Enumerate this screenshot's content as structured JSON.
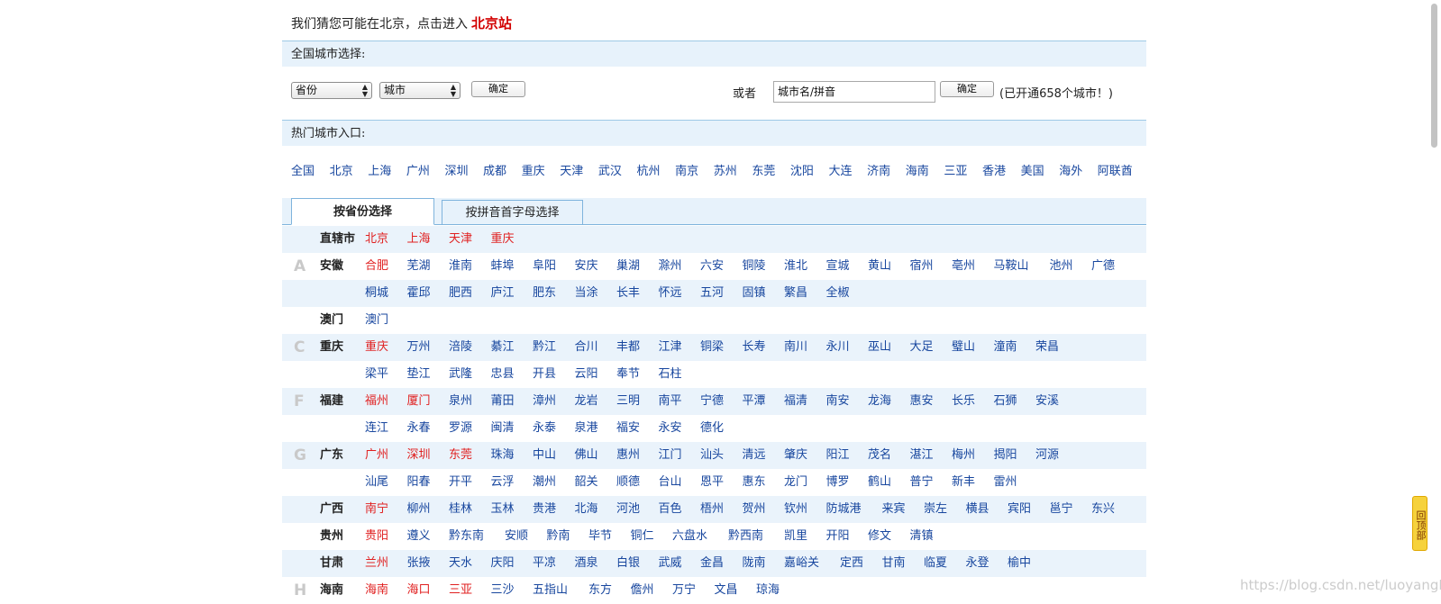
{
  "guess": {
    "prefix": "我们猜您可能在北京，点击进入",
    "city_link": "北京站"
  },
  "national": {
    "title": "全国城市选择:",
    "province_select": "省份",
    "city_select": "城市",
    "confirm_label": "确定",
    "or_label": "或者",
    "search_value": "城市名/拼音",
    "confirm2_label": "确定",
    "opened_text": "(已开通658个城市！)"
  },
  "hot": {
    "title": "热门城市入口:",
    "cities": [
      "全国",
      "北京",
      "上海",
      "广州",
      "深圳",
      "成都",
      "重庆",
      "天津",
      "武汉",
      "杭州",
      "南京",
      "苏州",
      "东莞",
      "沈阳",
      "大连",
      "济南",
      "海南",
      "三亚",
      "香港",
      "美国",
      "海外",
      "阿联酋"
    ]
  },
  "tabs": [
    {
      "label": "按省份选择"
    },
    {
      "label": "按拼音首字母选择"
    }
  ],
  "rows": [
    {
      "letter": "",
      "province": "直辖市",
      "cities": [
        {
          "n": "北京",
          "r": true
        },
        {
          "n": "上海",
          "r": true
        },
        {
          "n": "天津",
          "r": true
        },
        {
          "n": "重庆",
          "r": true
        }
      ]
    },
    {
      "letter": "A",
      "province": "安徽",
      "cities": [
        {
          "n": "合肥",
          "r": true
        },
        {
          "n": "芜湖"
        },
        {
          "n": "淮南"
        },
        {
          "n": "蚌埠"
        },
        {
          "n": "阜阳"
        },
        {
          "n": "安庆"
        },
        {
          "n": "巢湖"
        },
        {
          "n": "滁州"
        },
        {
          "n": "六安"
        },
        {
          "n": "铜陵"
        },
        {
          "n": "淮北"
        },
        {
          "n": "宣城"
        },
        {
          "n": "黄山"
        },
        {
          "n": "宿州"
        },
        {
          "n": "亳州"
        },
        {
          "n": "马鞍山"
        },
        {
          "n": "池州"
        },
        {
          "n": "广德"
        }
      ]
    },
    {
      "letter": "",
      "province": "",
      "cities": [
        {
          "n": "桐城"
        },
        {
          "n": "霍邱"
        },
        {
          "n": "肥西"
        },
        {
          "n": "庐江"
        },
        {
          "n": "肥东"
        },
        {
          "n": "当涂"
        },
        {
          "n": "长丰"
        },
        {
          "n": "怀远"
        },
        {
          "n": "五河"
        },
        {
          "n": "固镇"
        },
        {
          "n": "繁昌"
        },
        {
          "n": "全椒"
        }
      ]
    },
    {
      "letter": "",
      "province": "澳门",
      "cities": [
        {
          "n": "澳门"
        }
      ]
    },
    {
      "letter": "C",
      "province": "重庆",
      "cities": [
        {
          "n": "重庆",
          "r": true
        },
        {
          "n": "万州"
        },
        {
          "n": "涪陵"
        },
        {
          "n": "綦江"
        },
        {
          "n": "黔江"
        },
        {
          "n": "合川"
        },
        {
          "n": "丰都"
        },
        {
          "n": "江津"
        },
        {
          "n": "铜梁"
        },
        {
          "n": "长寿"
        },
        {
          "n": "南川"
        },
        {
          "n": "永川"
        },
        {
          "n": "巫山"
        },
        {
          "n": "大足"
        },
        {
          "n": "璧山"
        },
        {
          "n": "潼南"
        },
        {
          "n": "荣昌"
        }
      ]
    },
    {
      "letter": "",
      "province": "",
      "cities": [
        {
          "n": "梁平"
        },
        {
          "n": "垫江"
        },
        {
          "n": "武隆"
        },
        {
          "n": "忠县"
        },
        {
          "n": "开县"
        },
        {
          "n": "云阳"
        },
        {
          "n": "奉节"
        },
        {
          "n": "石柱"
        }
      ]
    },
    {
      "letter": "F",
      "province": "福建",
      "cities": [
        {
          "n": "福州",
          "r": true
        },
        {
          "n": "厦门",
          "r": true
        },
        {
          "n": "泉州"
        },
        {
          "n": "莆田"
        },
        {
          "n": "漳州"
        },
        {
          "n": "龙岩"
        },
        {
          "n": "三明"
        },
        {
          "n": "南平"
        },
        {
          "n": "宁德"
        },
        {
          "n": "平潭"
        },
        {
          "n": "福清"
        },
        {
          "n": "南安"
        },
        {
          "n": "龙海"
        },
        {
          "n": "惠安"
        },
        {
          "n": "长乐"
        },
        {
          "n": "石狮"
        },
        {
          "n": "安溪"
        }
      ]
    },
    {
      "letter": "",
      "province": "",
      "cities": [
        {
          "n": "连江"
        },
        {
          "n": "永春"
        },
        {
          "n": "罗源"
        },
        {
          "n": "闽清"
        },
        {
          "n": "永泰"
        },
        {
          "n": "泉港"
        },
        {
          "n": "福安"
        },
        {
          "n": "永安"
        },
        {
          "n": "德化"
        }
      ]
    },
    {
      "letter": "G",
      "province": "广东",
      "cities": [
        {
          "n": "广州",
          "r": true
        },
        {
          "n": "深圳",
          "r": true
        },
        {
          "n": "东莞",
          "r": true
        },
        {
          "n": "珠海"
        },
        {
          "n": "中山"
        },
        {
          "n": "佛山"
        },
        {
          "n": "惠州"
        },
        {
          "n": "江门"
        },
        {
          "n": "汕头"
        },
        {
          "n": "清远"
        },
        {
          "n": "肇庆"
        },
        {
          "n": "阳江"
        },
        {
          "n": "茂名"
        },
        {
          "n": "湛江"
        },
        {
          "n": "梅州"
        },
        {
          "n": "揭阳"
        },
        {
          "n": "河源"
        }
      ]
    },
    {
      "letter": "",
      "province": "",
      "cities": [
        {
          "n": "汕尾"
        },
        {
          "n": "阳春"
        },
        {
          "n": "开平"
        },
        {
          "n": "云浮"
        },
        {
          "n": "潮州"
        },
        {
          "n": "韶关"
        },
        {
          "n": "顺德"
        },
        {
          "n": "台山"
        },
        {
          "n": "恩平"
        },
        {
          "n": "惠东"
        },
        {
          "n": "龙门"
        },
        {
          "n": "博罗"
        },
        {
          "n": "鹤山"
        },
        {
          "n": "普宁"
        },
        {
          "n": "新丰"
        },
        {
          "n": "雷州"
        }
      ]
    },
    {
      "letter": "",
      "province": "广西",
      "cities": [
        {
          "n": "南宁",
          "r": true
        },
        {
          "n": "柳州"
        },
        {
          "n": "桂林"
        },
        {
          "n": "玉林"
        },
        {
          "n": "贵港"
        },
        {
          "n": "北海"
        },
        {
          "n": "河池"
        },
        {
          "n": "百色"
        },
        {
          "n": "梧州"
        },
        {
          "n": "贺州"
        },
        {
          "n": "钦州"
        },
        {
          "n": "防城港"
        },
        {
          "n": "来宾"
        },
        {
          "n": "崇左"
        },
        {
          "n": "横县"
        },
        {
          "n": "宾阳"
        },
        {
          "n": "邕宁"
        },
        {
          "n": "东兴"
        }
      ]
    },
    {
      "letter": "",
      "province": "贵州",
      "cities": [
        {
          "n": "贵阳",
          "r": true
        },
        {
          "n": "遵义"
        },
        {
          "n": "黔东南"
        },
        {
          "n": "安顺"
        },
        {
          "n": "黔南"
        },
        {
          "n": "毕节"
        },
        {
          "n": "铜仁"
        },
        {
          "n": "六盘水"
        },
        {
          "n": "黔西南"
        },
        {
          "n": "凯里"
        },
        {
          "n": "开阳"
        },
        {
          "n": "修文"
        },
        {
          "n": "清镇"
        }
      ]
    },
    {
      "letter": "",
      "province": "甘肃",
      "cities": [
        {
          "n": "兰州",
          "r": true
        },
        {
          "n": "张掖"
        },
        {
          "n": "天水"
        },
        {
          "n": "庆阳"
        },
        {
          "n": "平凉"
        },
        {
          "n": "酒泉"
        },
        {
          "n": "白银"
        },
        {
          "n": "武威"
        },
        {
          "n": "金昌"
        },
        {
          "n": "陇南"
        },
        {
          "n": "嘉峪关"
        },
        {
          "n": "定西"
        },
        {
          "n": "甘南"
        },
        {
          "n": "临夏"
        },
        {
          "n": "永登"
        },
        {
          "n": "榆中"
        }
      ]
    },
    {
      "letter": "H",
      "province": "海南",
      "cities": [
        {
          "n": "海南",
          "r": true
        },
        {
          "n": "海口",
          "r": true
        },
        {
          "n": "三亚",
          "r": true
        },
        {
          "n": "三沙"
        },
        {
          "n": "五指山"
        },
        {
          "n": "东方"
        },
        {
          "n": "儋州"
        },
        {
          "n": "万宁"
        },
        {
          "n": "文昌"
        },
        {
          "n": "琼海"
        }
      ]
    }
  ],
  "back_top": "回顶部",
  "watermark": "https://blog.csdn.net/luoyangIT"
}
